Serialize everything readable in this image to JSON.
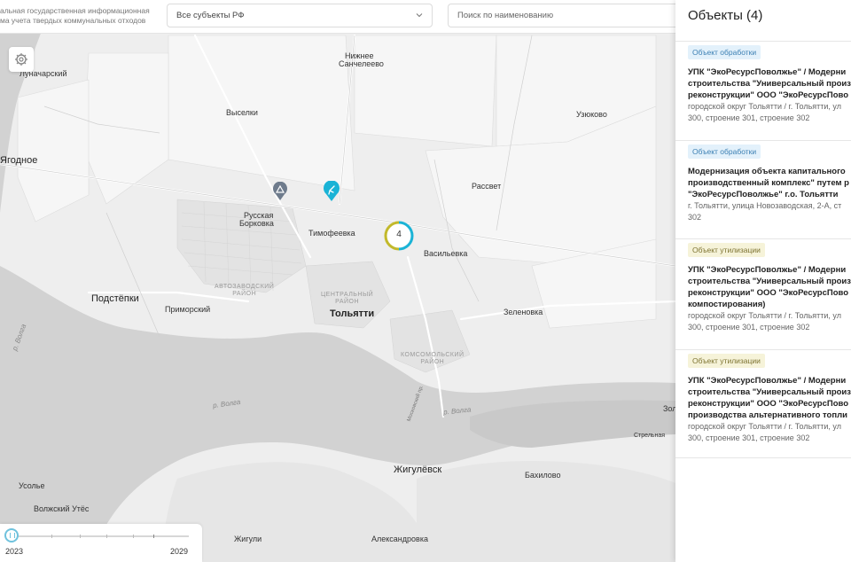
{
  "header": {
    "system_title_line1": "альная государственная информационная",
    "system_title_line2": "ма учета твердых коммунальных отходов",
    "region_select": "Все субъекты РФ",
    "search_placeholder": "Поиск по наименованию"
  },
  "map": {
    "places": {
      "lunacharsky": "Луначарский",
      "nizhnee": "Нижнее",
      "sancheleevo": "Санчелеево",
      "vyselki": "Выселки",
      "uzyukovo": "Узюково",
      "yagodnoe": "Ягодное",
      "rassvet": "Рассвет",
      "russkaya": "Русская",
      "borkovka": "Борковка",
      "timofeevka": "Тимофеевка",
      "vasilevka": "Васильевка",
      "podstepki": "Подстёпки",
      "primorsky": "Приморский",
      "tolyatti": "Тольятти",
      "zelenovka": "Зеленовка",
      "zhigulevsk": "Жигулёвск",
      "bakhilovo": "Бахилово",
      "usolye": "Усолье",
      "volzhsky_utyos": "Волжский Утёс",
      "zhiguli": "Жигули",
      "aleksandrovka": "Александровка",
      "strelnaya": "Стрельная",
      "zol": "Зол",
      "avtozavodsky_1": "АВТОЗАВОДСКИЙ",
      "avtozavodsky_2": "РАЙОН",
      "centralny_1": "ЦЕНТРАЛЬНЫЙ",
      "centralny_2": "РАЙОН",
      "komsomolsky_1": "КОМСОМОЛЬСКИЙ",
      "komsomolsky_2": "РАЙОН",
      "volga_1": "р. Волга",
      "volga_2": "р. Волга",
      "volga_3": "р. Волга",
      "kosmosdam": "Московский пр."
    },
    "cluster_count": "4",
    "colors": {
      "processing": "#1ab3d6",
      "utilization": "#c2b92b",
      "marker_gray": "#6e7b8c"
    }
  },
  "timeline": {
    "start_year": "2023",
    "end_year": "2029",
    "position_fraction": 0
  },
  "panel": {
    "title": "Объекты (4)",
    "items": [
      {
        "badge": "Объект обработки",
        "type": "processing",
        "title_lines": [
          "УПК \"ЭкоРесурсПоволжье\" / Модерни",
          "строительства \"Универсальный произ",
          "реконструкции\" ООО \"ЭкоРесурсПово"
        ],
        "addr_lines": [
          "городской округ Тольятти / г. Тольятти, ул",
          "300, строение 301, строение 302"
        ]
      },
      {
        "badge": "Объект обработки",
        "type": "processing",
        "title_lines": [
          "Модернизация объекта капитального",
          "производственный комплекс\" путем р",
          "\"ЭкоРесурсПоволжье\" г.о. Тольятти"
        ],
        "addr_lines": [
          "г. Тольятти, улица Новозаводская, 2-А, ст",
          "302"
        ]
      },
      {
        "badge": "Объект утилизации",
        "type": "utilization",
        "title_lines": [
          "УПК \"ЭкоРесурсПоволжье\" / Модерни",
          "строительства \"Универсальный произ",
          "реконструкции\" ООО \"ЭкоРесурсПово",
          "компостирования)"
        ],
        "addr_lines": [
          "городской округ Тольятти / г. Тольятти, ул",
          "300, строение 301, строение 302"
        ]
      },
      {
        "badge": "Объект утилизации",
        "type": "utilization",
        "title_lines": [
          "УПК \"ЭкоРесурсПоволжье\" / Модерни",
          "строительства \"Универсальный произ",
          "реконструкции\" ООО \"ЭкоРесурсПово",
          "производства альтернативного топли"
        ],
        "addr_lines": [
          "городской округ Тольятти / г. Тольятти, ул",
          "300, строение 301, строение 302"
        ]
      }
    ]
  }
}
